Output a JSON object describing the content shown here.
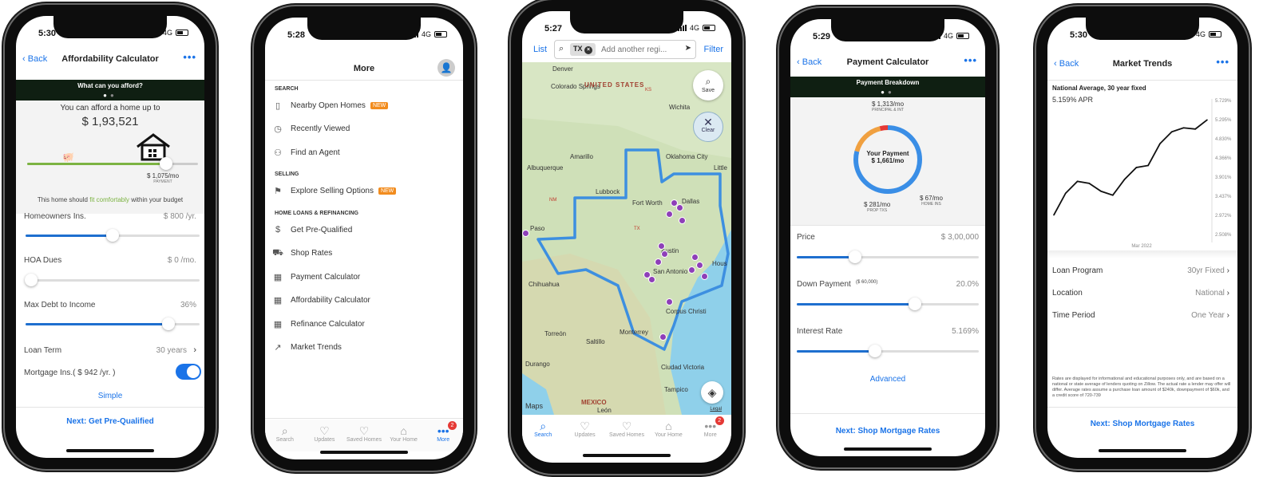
{
  "status": {
    "p1_time": "5:30",
    "p2_time": "5:28",
    "p3_time": "5:27",
    "p4_time": "5:29",
    "p5_time": "5:30",
    "network": "4G"
  },
  "afford": {
    "back": "Back",
    "title": "Affordability Calculator",
    "more": "•••",
    "banner": "What can you afford?",
    "headline": "You can afford a home up to",
    "amount": "$ 1,93,521",
    "monthly": "$ 1,075/mo",
    "monthly_label": "PAYMENT",
    "note_pre": "This home should ",
    "note_hl": "fit comfortably",
    "note_post": " within your budget",
    "homeowners_label": "Homeowners Ins.",
    "homeowners_value": "$ 800 /yr.",
    "homeowners_level": 0.5,
    "hoa_label": "HOA Dues",
    "hoa_value": "$ 0 /mo.",
    "hoa_level": 0.03,
    "dti_label": "Max Debt to Income",
    "dti_value": "36%",
    "dti_level": 0.82,
    "term_label": "Loan Term",
    "term_value": "30 years",
    "mortgage_ins_label": "Mortgage Ins.( $ 942 /yr. )",
    "simple": "Simple",
    "next": "Next: Get Pre-Qualified"
  },
  "more": {
    "title": "More",
    "sec_search": "SEARCH",
    "sec_selling": "SELLING",
    "sec_loans": "HOME LOANS & REFINANCING",
    "items_search": [
      {
        "label": "Nearby Open Homes",
        "badge": "NEW"
      },
      {
        "label": "Recently Viewed"
      },
      {
        "label": "Find an Agent"
      }
    ],
    "items_selling": [
      {
        "label": "Explore Selling Options",
        "badge": "NEW"
      }
    ],
    "items_loans": [
      {
        "label": "Get Pre-Qualified"
      },
      {
        "label": "Shop Rates"
      },
      {
        "label": "Payment Calculator"
      },
      {
        "label": "Affordability Calculator"
      },
      {
        "label": "Refinance Calculator"
      },
      {
        "label": "Market Trends"
      }
    ]
  },
  "tabs": {
    "search": "Search",
    "updates": "Updates",
    "saved": "Saved Homes",
    "home": "Your Home",
    "more": "More",
    "badge": "2"
  },
  "map": {
    "list": "List",
    "chip": "TX",
    "placeholder": "Add another regi...",
    "filter": "Filter",
    "save": "Save",
    "clear": "Clear",
    "country": "UNITED STATES",
    "mexico": "MEXICO",
    "maps": "Maps",
    "legal": "Legal",
    "cities": [
      "Denver",
      "Colorado Springs",
      "Wichita",
      "Oklahoma City",
      "Albuquerque",
      "Amarillo",
      "Lubbock",
      "Fort Worth",
      "Dallas",
      "Paso",
      "Austin",
      "San Antonio",
      "Corpus Christi",
      "Chihuahua",
      "Torreón",
      "Monterrey",
      "Saltillo",
      "Durango",
      "Ciudad Victoria",
      "Tampico",
      "León",
      "Little",
      "Hous",
      "KS",
      "NM",
      "TX"
    ]
  },
  "payment": {
    "back": "Back",
    "title": "Payment Calculator",
    "more": "•••",
    "banner": "Payment Breakdown",
    "principal": "$ 1,313/mo",
    "principal_label": "PRINCIPAL & INT",
    "your_payment": "Your Payment",
    "total": "$ 1,661/mo",
    "tax": "$ 281/mo",
    "tax_label": "PROP TXS",
    "ins": "$ 67/mo",
    "ins_label": "HOME INS",
    "price_label": "Price",
    "price_value": "$ 3,00,000",
    "price_level": 0.32,
    "down_label": "Down Payment",
    "down_sub": "($ 60,000)",
    "down_value": "20.0%",
    "down_level": 0.65,
    "rate_label": "Interest Rate",
    "rate_value": "5.169%",
    "rate_level": 0.43,
    "advanced": "Advanced",
    "next": "Next: Shop Mortgage Rates",
    "donut": {
      "principal": 0.79,
      "tax": 0.17,
      "ins": 0.04,
      "colors": {
        "principal": "#3a8ee6",
        "tax": "#f0a040",
        "ins": "#e53935"
      }
    }
  },
  "trends": {
    "back": "Back",
    "title": "Market Trends",
    "more": "•••",
    "heading": "National Average, 30 year fixed",
    "apr": "5.159% APR",
    "yticks": [
      "5.729%",
      "5.295%",
      "4.830%",
      "4.366%",
      "3.901%",
      "3.437%",
      "2.972%",
      "2.508%"
    ],
    "xlabel": "Mar 2022",
    "program_label": "Loan Program",
    "program_value": "30yr Fixed",
    "location_label": "Location",
    "location_value": "National",
    "period_label": "Time Period",
    "period_value": "One Year",
    "disclaimer": "Rates are displayed for informational and educational purposes only, and are based on a national or state average of lenders quoting on Zillow. The actual rate a lender may offer will differ. Average rates assume a purchase loan amount of $240k, downpayment of $60k, and a credit score of 720-739",
    "next": "Next: Shop Mortgage Rates",
    "chart_data": {
      "type": "line",
      "x": [
        0,
        1,
        2,
        3,
        4,
        5,
        6,
        7,
        8,
        9,
        10,
        11,
        12,
        13
      ],
      "y": [
        3.0,
        3.55,
        3.85,
        3.8,
        3.6,
        3.5,
        3.9,
        4.2,
        4.25,
        4.8,
        5.1,
        5.2,
        5.17,
        5.4
      ],
      "ylim": [
        2.508,
        5.729
      ],
      "xlabel": "Mar 2022",
      "grid": false,
      "legend": "none"
    }
  }
}
